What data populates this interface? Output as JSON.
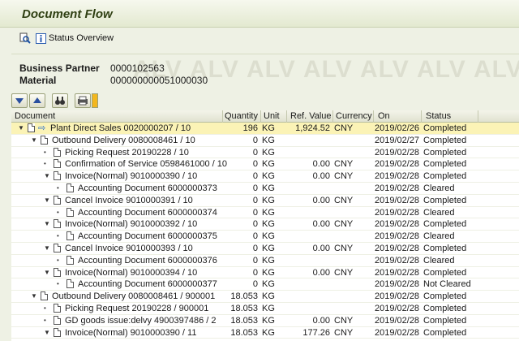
{
  "title": "Document Flow",
  "toolbar": {
    "status_overview": "Status Overview"
  },
  "header": {
    "watermark": "ALV",
    "business_partner_label": "Business Partner",
    "business_partner_value": "0000102563",
    "material_label": "Material",
    "material_value": "000000000051000030"
  },
  "columns": {
    "document": "Document",
    "quantity": "Quantity",
    "unit": "Unit",
    "ref_value": "Ref. Value",
    "currency": "Currency",
    "on": "On",
    "status": "Status"
  },
  "rows": [
    {
      "level": 0,
      "tree": "open",
      "icon": "arrow",
      "doc": "Plant Direct Sales 0020000207 / 10",
      "qty": "196",
      "unit": "KG",
      "ref": "1,924.52",
      "cur": "CNY",
      "on": "2019/02/26",
      "status": "Completed",
      "selected": true
    },
    {
      "level": 1,
      "tree": "open",
      "icon": "doc",
      "doc": "Outbound Delivery 0080008461 / 10",
      "qty": "0",
      "unit": "KG",
      "ref": "",
      "cur": "",
      "on": "2019/02/27",
      "status": "Completed"
    },
    {
      "level": 2,
      "tree": "leaf",
      "icon": "doc",
      "doc": "Picking Request 20190228 / 10",
      "qty": "0",
      "unit": "KG",
      "ref": "",
      "cur": "",
      "on": "2019/02/28",
      "status": "Completed"
    },
    {
      "level": 2,
      "tree": "leaf",
      "icon": "doc",
      "doc": "Confirmation of Service 0598461000 / 10",
      "qty": "0",
      "unit": "KG",
      "ref": "0.00",
      "cur": "CNY",
      "on": "2019/02/28",
      "status": "Completed"
    },
    {
      "level": 2,
      "tree": "open",
      "icon": "doc",
      "doc": "Invoice(Normal) 9010000390 / 10",
      "qty": "0",
      "unit": "KG",
      "ref": "0.00",
      "cur": "CNY",
      "on": "2019/02/28",
      "status": "Completed"
    },
    {
      "level": 3,
      "tree": "leaf",
      "icon": "doc",
      "doc": "Accounting Document 6000000373",
      "qty": "0",
      "unit": "KG",
      "ref": "",
      "cur": "",
      "on": "2019/02/28",
      "status": "Cleared"
    },
    {
      "level": 2,
      "tree": "open",
      "icon": "doc",
      "doc": "Cancel Invoice 9010000391 / 10",
      "qty": "0",
      "unit": "KG",
      "ref": "0.00",
      "cur": "CNY",
      "on": "2019/02/28",
      "status": "Completed"
    },
    {
      "level": 3,
      "tree": "leaf",
      "icon": "doc",
      "doc": "Accounting Document 6000000374",
      "qty": "0",
      "unit": "KG",
      "ref": "",
      "cur": "",
      "on": "2019/02/28",
      "status": "Cleared"
    },
    {
      "level": 2,
      "tree": "open",
      "icon": "doc",
      "doc": "Invoice(Normal) 9010000392 / 10",
      "qty": "0",
      "unit": "KG",
      "ref": "0.00",
      "cur": "CNY",
      "on": "2019/02/28",
      "status": "Completed"
    },
    {
      "level": 3,
      "tree": "leaf",
      "icon": "doc",
      "doc": "Accounting Document 6000000375",
      "qty": "0",
      "unit": "KG",
      "ref": "",
      "cur": "",
      "on": "2019/02/28",
      "status": "Cleared"
    },
    {
      "level": 2,
      "tree": "open",
      "icon": "doc",
      "doc": "Cancel Invoice 9010000393 / 10",
      "qty": "0",
      "unit": "KG",
      "ref": "0.00",
      "cur": "CNY",
      "on": "2019/02/28",
      "status": "Completed"
    },
    {
      "level": 3,
      "tree": "leaf",
      "icon": "doc",
      "doc": "Accounting Document 6000000376",
      "qty": "0",
      "unit": "KG",
      "ref": "",
      "cur": "",
      "on": "2019/02/28",
      "status": "Cleared"
    },
    {
      "level": 2,
      "tree": "open",
      "icon": "doc",
      "doc": "Invoice(Normal) 9010000394 / 10",
      "qty": "0",
      "unit": "KG",
      "ref": "0.00",
      "cur": "CNY",
      "on": "2019/02/28",
      "status": "Completed"
    },
    {
      "level": 3,
      "tree": "leaf",
      "icon": "doc",
      "doc": "Accounting Document 6000000377",
      "qty": "0",
      "unit": "KG",
      "ref": "",
      "cur": "",
      "on": "2019/02/28",
      "status": "Not Cleared"
    },
    {
      "level": 1,
      "tree": "open",
      "icon": "doc",
      "doc": "Outbound Delivery 0080008461 / 900001",
      "qty": "18.053",
      "unit": "KG",
      "ref": "",
      "cur": "",
      "on": "2019/02/28",
      "status": "Completed"
    },
    {
      "level": 2,
      "tree": "leaf",
      "icon": "doc",
      "doc": "Picking Request 20190228 / 900001",
      "qty": "18.053",
      "unit": "KG",
      "ref": "",
      "cur": "",
      "on": "2019/02/28",
      "status": "Completed"
    },
    {
      "level": 2,
      "tree": "leaf",
      "icon": "doc",
      "doc": "GD goods issue:delvy 4900397486 / 2",
      "qty": "18.053",
      "unit": "KG",
      "ref": "0.00",
      "cur": "CNY",
      "on": "2019/02/28",
      "status": "Completed"
    },
    {
      "level": 2,
      "tree": "open",
      "icon": "doc",
      "doc": "Invoice(Normal) 9010000390 / 11",
      "qty": "18.053",
      "unit": "KG",
      "ref": "177.26",
      "cur": "CNY",
      "on": "2019/02/28",
      "status": "Completed"
    }
  ],
  "colors": {
    "title": "#2f3f12",
    "selected_row": "#fbf3b6",
    "header_bg": "#eef1e4"
  }
}
